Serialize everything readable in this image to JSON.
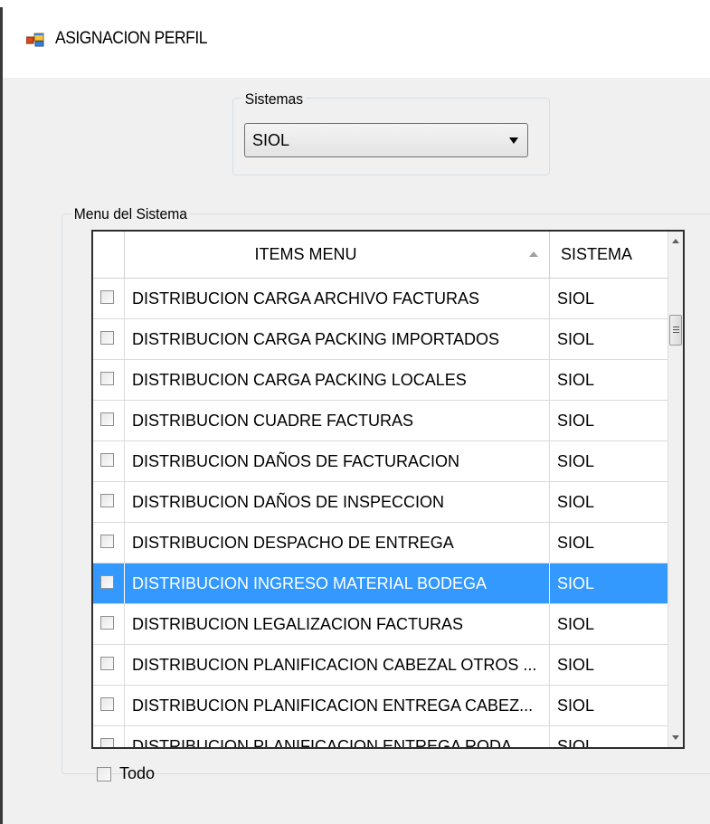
{
  "window": {
    "title": "ASIGNACION PERFIL",
    "icon": "app-window-icon"
  },
  "sistemas": {
    "label": "Sistemas",
    "selected": "SIOL"
  },
  "menu_group": {
    "label": "Menu del Sistema"
  },
  "grid": {
    "columns": [
      "ITEMS MENU",
      "SISTEMA"
    ],
    "sorted_column": "ITEMS MENU",
    "rows": [
      {
        "item": "DISTRIBUCION CARGA ARCHIVO FACTURAS",
        "sistema": "SIOL",
        "checked": false,
        "selected": false
      },
      {
        "item": "DISTRIBUCION CARGA PACKING IMPORTADOS",
        "sistema": "SIOL",
        "checked": false,
        "selected": false
      },
      {
        "item": "DISTRIBUCION CARGA PACKING LOCALES",
        "sistema": "SIOL",
        "checked": false,
        "selected": false
      },
      {
        "item": "DISTRIBUCION CUADRE FACTURAS",
        "sistema": "SIOL",
        "checked": false,
        "selected": false
      },
      {
        "item": "DISTRIBUCION DAÑOS DE FACTURACION",
        "sistema": "SIOL",
        "checked": false,
        "selected": false
      },
      {
        "item": "DISTRIBUCION DAÑOS DE INSPECCION",
        "sistema": "SIOL",
        "checked": false,
        "selected": false
      },
      {
        "item": "DISTRIBUCION DESPACHO DE ENTREGA",
        "sistema": "SIOL",
        "checked": false,
        "selected": false
      },
      {
        "item": "DISTRIBUCION INGRESO MATERIAL BODEGA",
        "sistema": "SIOL",
        "checked": false,
        "selected": true
      },
      {
        "item": "DISTRIBUCION LEGALIZACION FACTURAS",
        "sistema": "SIOL",
        "checked": false,
        "selected": false
      },
      {
        "item": "DISTRIBUCION PLANIFICACION CABEZAL OTROS ...",
        "sistema": "SIOL",
        "checked": false,
        "selected": false
      },
      {
        "item": "DISTRIBUCION PLANIFICACION ENTREGA CABEZ...",
        "sistema": "SIOL",
        "checked": false,
        "selected": false
      },
      {
        "item": "DISTRIBUCION PLANIFICACION ENTREGA RODA...",
        "sistema": "SIOL",
        "checked": false,
        "selected": false
      }
    ]
  },
  "todo": {
    "label": "Todo",
    "checked": false
  },
  "colors": {
    "selection": "#3399ff",
    "client_bg": "#f0f0f0",
    "group_border": "#d5dfe5"
  }
}
